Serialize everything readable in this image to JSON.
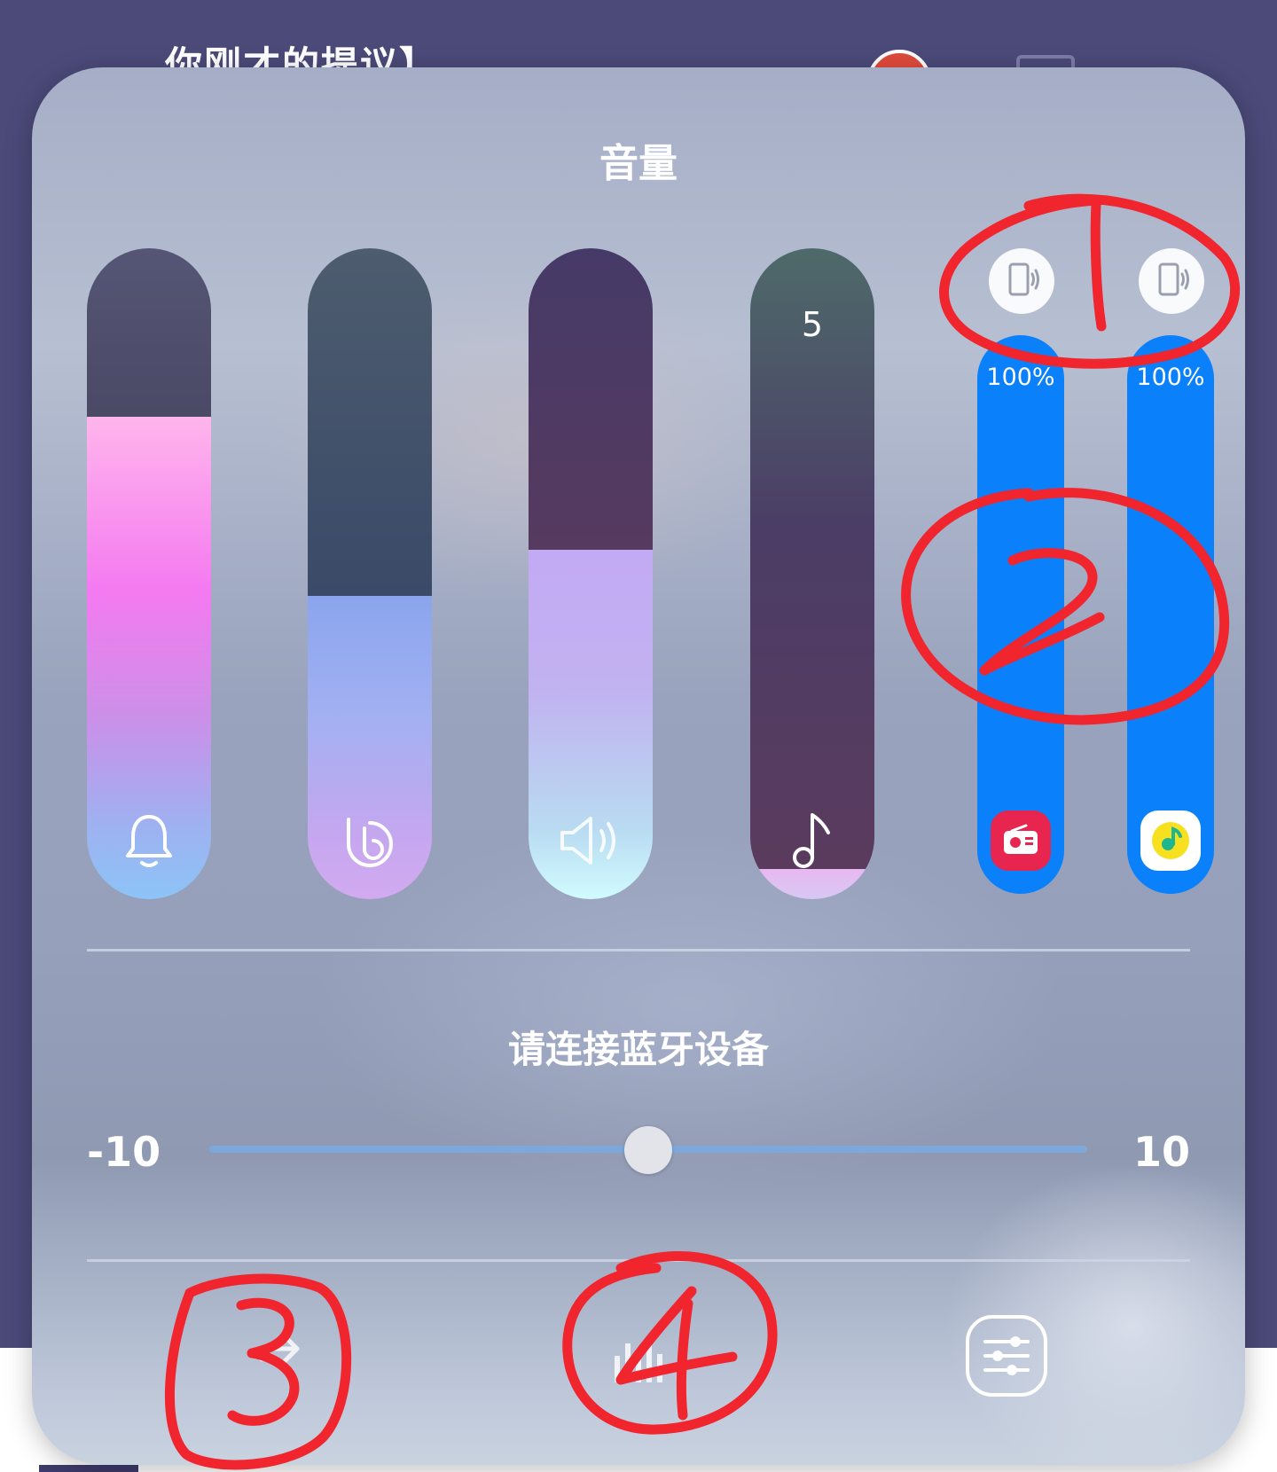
{
  "background": {
    "title": "你刚才的提议】"
  },
  "panel": {
    "title": "音量",
    "sliders": [
      {
        "id": "notification",
        "icon": "bell-icon",
        "level": 0.74,
        "value": ""
      },
      {
        "id": "bixby",
        "icon": "bixby-icon",
        "level": 0.47,
        "value": ""
      },
      {
        "id": "system",
        "icon": "speaker-icon",
        "level": 0.54,
        "value": ""
      },
      {
        "id": "media",
        "icon": "music-note-icon",
        "level": 0.05,
        "value": "5"
      }
    ],
    "app_volumes": [
      {
        "percent": "100%",
        "device_icon": "phone-sound-icon",
        "app_icon": "radio-app-icon"
      },
      {
        "percent": "100%",
        "device_icon": "phone-sound-icon",
        "app_icon": "music-app-icon"
      }
    ],
    "bluetooth_label": "请连接蓝牙设备",
    "balance": {
      "min": "-10",
      "max": "10",
      "value": 0
    },
    "bottom_buttons": [
      {
        "id": "share",
        "icon": "share-icon"
      },
      {
        "id": "equalizer",
        "icon": "equalizer-icon"
      },
      {
        "id": "settings",
        "icon": "sliders-settings-icon"
      }
    ]
  },
  "annotations": [
    "1",
    "2",
    "3",
    "4"
  ],
  "colors": {
    "accent": "#0a80fb",
    "annotation": "#f0252e"
  }
}
